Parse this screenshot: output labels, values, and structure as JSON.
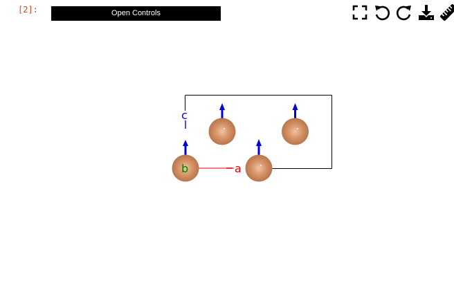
{
  "cell": {
    "prompt": "[2]:"
  },
  "controls": {
    "open_label": "Open Controls"
  },
  "toolbar": {
    "icons": [
      "fullscreen-icon",
      "undo-icon",
      "redo-icon",
      "download-icon",
      "measure-icon"
    ]
  },
  "viewer": {
    "axes": {
      "a_label": "a",
      "b_label": "b",
      "c_label": "c",
      "a_color": "#e00000",
      "b_color": "#008000",
      "c_color": "#0000ff"
    },
    "cell_border_color": "#000000",
    "atom_color": "#d8956a",
    "spin_color": "#0000dd",
    "atom_count": 4
  }
}
